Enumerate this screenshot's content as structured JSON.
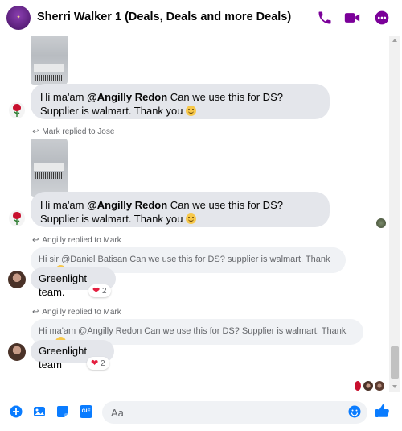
{
  "header": {
    "title": "Sherri Walker 1 (Deals, Deals and more Deals)",
    "icons": [
      "phone-icon",
      "video-camera-icon",
      "more-icon"
    ],
    "accent_color": "#7b0099"
  },
  "messages": [
    {
      "text_prefix": "Hi ma'am ",
      "mention": "@Angilly Redon",
      "text_suffix": " Can we use this for DS? Supplier is walmart. Thank you"
    },
    {
      "reply_note": "Mark replied to Jose",
      "text_prefix": "Hi ma'am ",
      "mention": "@Angilly Redon",
      "text_suffix": "  Can we use this for DS? Supplier is walmart. Thank you"
    },
    {
      "reply_note": "Angilly replied to Mark",
      "quoted": "Hi sir @Daniel Batisan Can we use this for DS? supplier is walmart. Thank you",
      "text": "Greenlight team.",
      "reaction_count": "2"
    },
    {
      "reply_note": "Angilly replied to Mark",
      "quoted": "Hi ma'am @Angilly Redon  Can we use this for DS? Supplier is walmart. Thank you",
      "text": "Greenlight team",
      "reaction_count": "2"
    }
  ],
  "composer": {
    "placeholder": "Aa",
    "icons": [
      "plus-icon",
      "photo-icon",
      "sticker-icon",
      "gif-icon",
      "emoji-icon",
      "thumbs-up-icon"
    ],
    "gif_label": "GIF"
  },
  "colors": {
    "messenger_blue": "#0a7cff",
    "bubble_gray": "#e4e6eb",
    "heart_red": "#e41e3f"
  }
}
